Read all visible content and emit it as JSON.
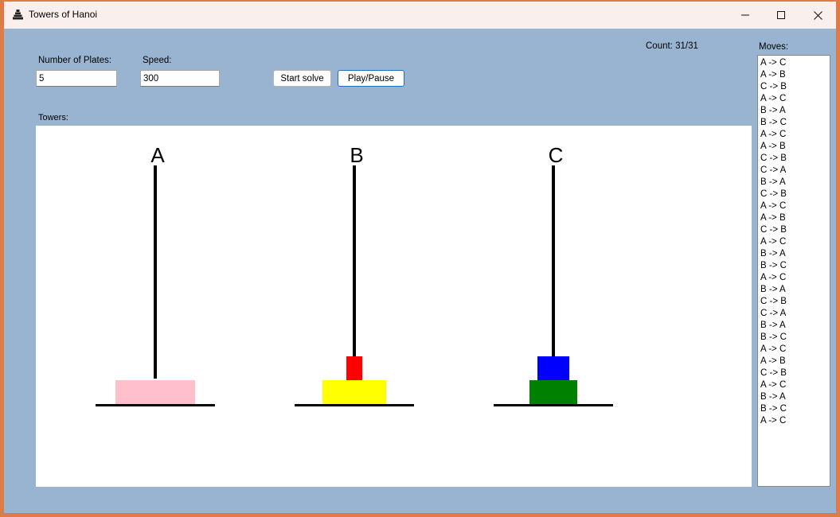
{
  "window": {
    "title": "Towers of Hanoi"
  },
  "controls": {
    "plates_label": "Number of Plates:",
    "plates_value": "5",
    "speed_label": "Speed:",
    "speed_value": "300",
    "start_label": "Start solve",
    "playpause_label": "Play/Pause"
  },
  "count_text": "Count: 31/31",
  "towers_label": "Towers:",
  "towers": [
    {
      "name": "A",
      "plates": [
        {
          "color": "#ffc0cb",
          "size": 5
        }
      ]
    },
    {
      "name": "B",
      "plates": [
        {
          "color": "#ffff00",
          "size": 4
        },
        {
          "color": "#ff0000",
          "size": 1
        }
      ]
    },
    {
      "name": "C",
      "plates": [
        {
          "color": "#008000",
          "size": 3
        },
        {
          "color": "#0000ff",
          "size": 2
        }
      ]
    }
  ],
  "moves_label": "Moves:",
  "moves": [
    "A -> C",
    "A -> B",
    "C -> B",
    "A -> C",
    "B -> A",
    "B -> C",
    "A -> C",
    "A -> B",
    "C -> B",
    "C -> A",
    "B -> A",
    "C -> B",
    "A -> C",
    "A -> B",
    "C -> B",
    "A -> C",
    "B -> A",
    "B -> C",
    "A -> C",
    "B -> A",
    "C -> B",
    "C -> A",
    "B -> A",
    "B -> C",
    "A -> C",
    "A -> B",
    "C -> B",
    "A -> C",
    "B -> A",
    "B -> C",
    "A -> C"
  ]
}
